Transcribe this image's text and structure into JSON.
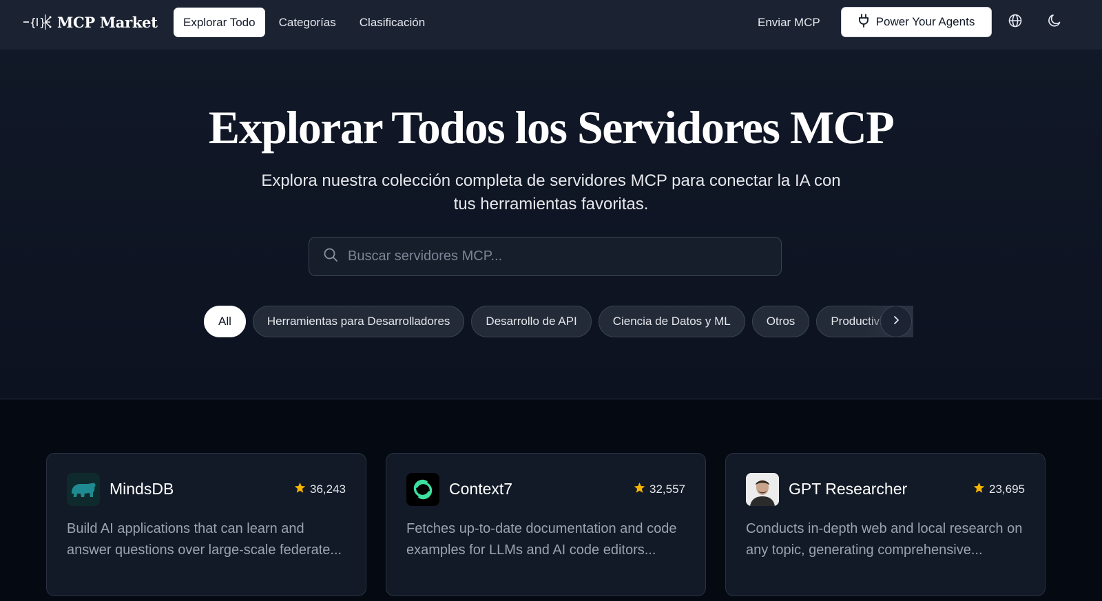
{
  "header": {
    "logo_text": "MCP Market",
    "nav": [
      {
        "label": "Explorar Todo",
        "active": true
      },
      {
        "label": "Categorías",
        "active": false
      },
      {
        "label": "Clasificación",
        "active": false
      }
    ],
    "submit_label": "Enviar MCP",
    "power_label": "Power Your Agents"
  },
  "hero": {
    "title": "Explorar Todos los Servidores MCP",
    "subtitle": "Explora nuestra colección completa de servidores MCP para conectar la IA con tus herramientas favoritas.",
    "search_placeholder": "Buscar servidores MCP..."
  },
  "chips": [
    "All",
    "Herramientas para Desarrolladores",
    "Desarrollo de API",
    "Ciencia de Datos y ML",
    "Otros",
    "Productividad"
  ],
  "cards": [
    {
      "name": "MindsDB",
      "stars": "36,243",
      "desc": "Build AI applications that can learn and answer questions over large-scale federate...",
      "icon": "bear-icon"
    },
    {
      "name": "Context7",
      "stars": "32,557",
      "desc": "Fetches up-to-date documentation and code examples for LLMs and AI code editors...",
      "icon": "context7-logo-icon"
    },
    {
      "name": "GPT Researcher",
      "stars": "23,695",
      "desc": "Conducts in-depth web and local research on any topic, generating comprehensive...",
      "icon": "avatar-icon"
    }
  ],
  "colors": {
    "header_bg": "#1b2232",
    "page_bg": "#0a0e17",
    "star": "#f5b400",
    "context7_green": "#3ee0a0"
  }
}
